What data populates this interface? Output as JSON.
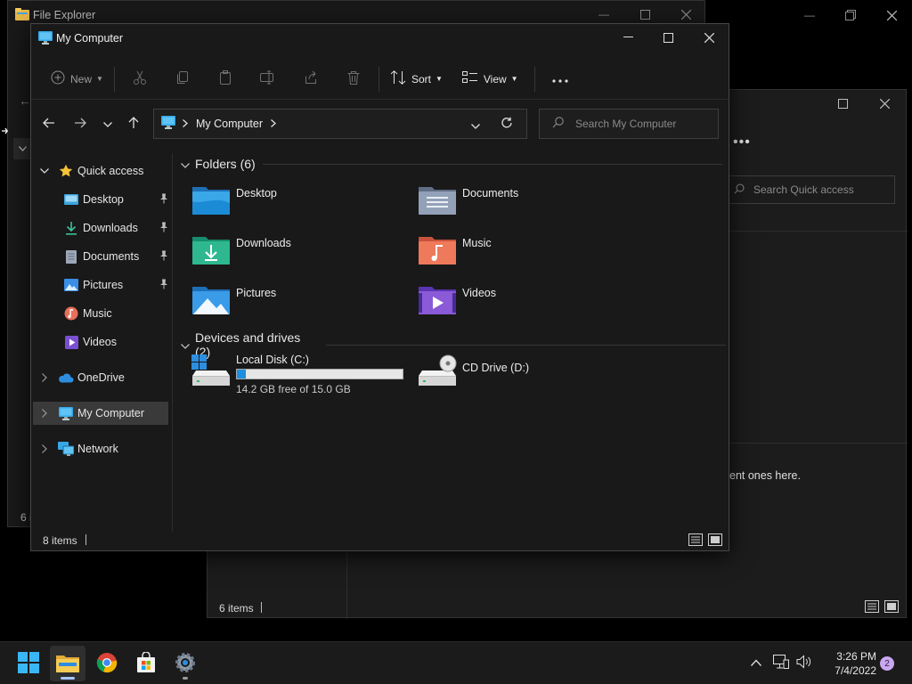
{
  "bg_windows": {
    "file_explorer": {
      "title": "File Explorer",
      "status_count": "6 i"
    },
    "quick_access": {
      "search_placeholder": "Search Quick access",
      "empty_text": "ent ones here.",
      "status_count": "6 items"
    }
  },
  "window": {
    "title": "My Computer",
    "colors": {
      "accent": "#4cc2ff",
      "selection": "#3a3a3a",
      "bg": "#191919"
    }
  },
  "toolbar": {
    "new_label": "New",
    "sort_label": "Sort",
    "view_label": "View"
  },
  "address": {
    "crumb": "My Computer",
    "search_placeholder": "Search My Computer"
  },
  "nav": {
    "items": [
      {
        "label": "Quick access",
        "icon": "star-icon"
      },
      {
        "label": "Desktop",
        "icon": "desktop-folder-icon",
        "pinned": true
      },
      {
        "label": "Downloads",
        "icon": "download-icon",
        "pinned": true
      },
      {
        "label": "Documents",
        "icon": "document-icon",
        "pinned": true
      },
      {
        "label": "Pictures",
        "icon": "pictures-icon",
        "pinned": true
      },
      {
        "label": "Music",
        "icon": "music-icon"
      },
      {
        "label": "Videos",
        "icon": "video-icon"
      },
      {
        "label": "OneDrive",
        "icon": "cloud-icon"
      },
      {
        "label": "My Computer",
        "icon": "computer-icon",
        "selected": true
      },
      {
        "label": "Network",
        "icon": "network-icon"
      }
    ]
  },
  "folders": {
    "header": "Folders (6)",
    "items": [
      {
        "name": "Desktop"
      },
      {
        "name": "Documents"
      },
      {
        "name": "Downloads"
      },
      {
        "name": "Music"
      },
      {
        "name": "Pictures"
      },
      {
        "name": "Videos"
      }
    ]
  },
  "drives": {
    "header": "Devices and drives (2)",
    "items": [
      {
        "name": "Local Disk (C:)",
        "free_text": "14.2 GB free of 15.0 GB",
        "used_fraction": 0.053
      },
      {
        "name": "CD Drive (D:)"
      }
    ]
  },
  "status": {
    "count": "8 items"
  },
  "taskbar": {
    "time": "3:26 PM",
    "date": "7/4/2022",
    "notifications": "2"
  }
}
